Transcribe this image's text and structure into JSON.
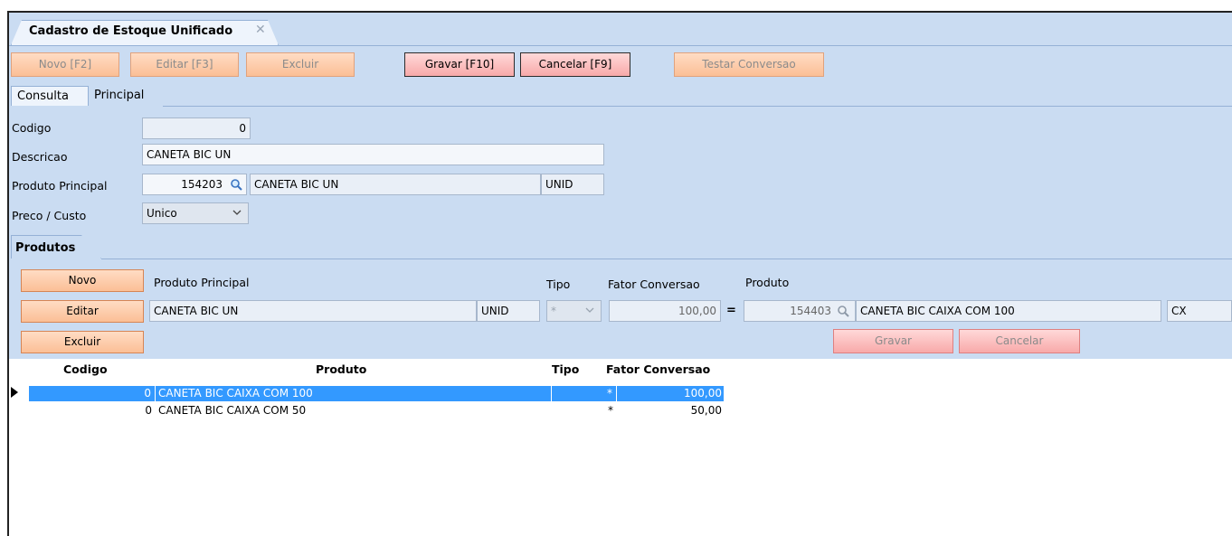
{
  "window": {
    "tab_title": "Cadastro de Estoque Unificado",
    "close_glyph": "✕"
  },
  "toolbar": {
    "novo": "Novo [F2]",
    "editar": "Editar [F3]",
    "excluir": "Excluir",
    "gravar": "Gravar [F10]",
    "cancelar": "Cancelar [F9]",
    "testar": "Testar Conversao"
  },
  "tabs": {
    "consulta": "Consulta",
    "principal": "Principal"
  },
  "form": {
    "codigo_label": "Codigo",
    "codigo_value": "0",
    "descricao_label": "Descricao",
    "descricao_value": "CANETA BIC UN",
    "produto_principal_label": "Produto Principal",
    "produto_principal_code": "154203",
    "produto_principal_name": "CANETA BIC UN",
    "produto_principal_unit": "UNID",
    "preco_label": "Preco / Custo",
    "preco_value": "Unico"
  },
  "produtos": {
    "tab_label": "Produtos",
    "novo": "Novo",
    "editar": "Editar",
    "excluir": "Excluir",
    "hdr_produto_principal": "Produto Principal",
    "hdr_tipo": "Tipo",
    "hdr_fator": "Fator Conversao",
    "hdr_produto": "Produto",
    "principal_name": "CANETA BIC UN",
    "principal_unit": "UNID",
    "tipo_value": "*",
    "fator_value": "100,00",
    "equals": "=",
    "produto_code": "154403",
    "produto_name": "CANETA BIC CAIXA COM 100",
    "produto_unit": "CX",
    "gravar": "Gravar",
    "cancelar": "Cancelar"
  },
  "grid": {
    "columns": [
      "Codigo",
      "Produto",
      "Tipo",
      "Fator Conversao"
    ],
    "rows": [
      {
        "codigo": "0",
        "produto": "CANETA BIC CAIXA COM 100",
        "tipo": "*",
        "fator": "100,00",
        "selected": true
      },
      {
        "codigo": "0",
        "produto": "CANETA BIC CAIXA COM 50",
        "tipo": "*",
        "fator": "50,00",
        "selected": false
      }
    ]
  },
  "colors": {
    "panel": "#cadcf2",
    "button": "#fbbf96",
    "selection": "#3399ff"
  },
  "icons": [
    "search-icon",
    "chevron-down-icon",
    "row-pointer-icon",
    "close-icon"
  ]
}
